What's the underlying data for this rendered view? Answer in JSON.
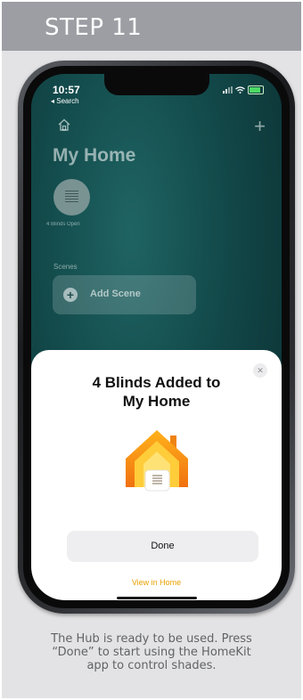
{
  "header": {
    "step": "STEP 11"
  },
  "status_bar": {
    "time": "10:57",
    "back_label": "◂ Search"
  },
  "home": {
    "title": "My Home",
    "blind_tile_label": "4 Blinds Open",
    "scenes_label": "Scenes",
    "add_scene_label": "Add Scene"
  },
  "sheet": {
    "title_line1": "4 Blinds Added to",
    "title_line2": "My Home",
    "close_glyph": "✕",
    "done_label": "Done",
    "view_label": "View in Home"
  },
  "caption": {
    "line1": "The Hub is ready to be used. Press",
    "line2": "“Done” to start using the HomeKit",
    "line3": "app to control shades."
  },
  "colors": {
    "accent": "#e8a100",
    "header_bg": "#9c9ea3",
    "screen_teal": "#124849"
  },
  "icons": [
    "home-icon",
    "plus-icon",
    "blinds-icon",
    "add-icon",
    "close-icon",
    "homekit-logo-icon",
    "signal-icon",
    "wifi-icon",
    "battery-icon"
  ]
}
